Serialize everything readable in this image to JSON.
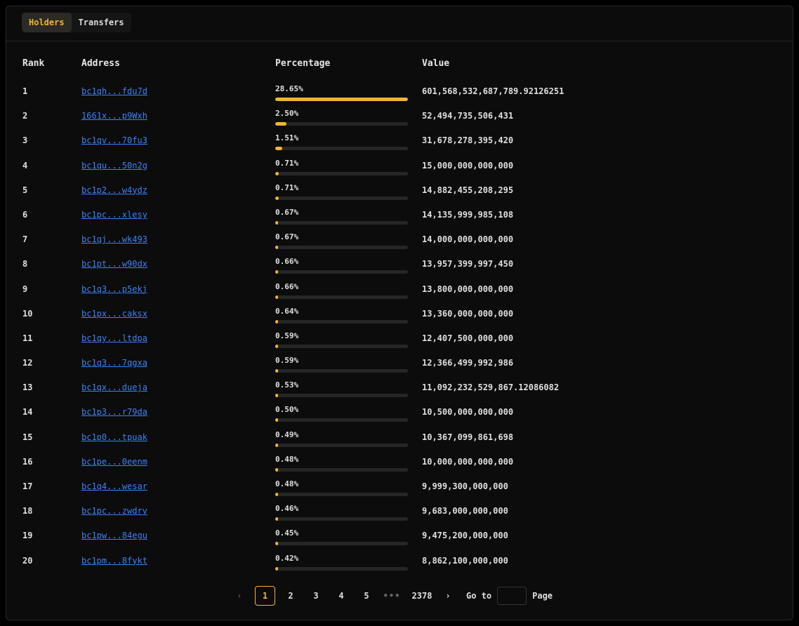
{
  "tabs": [
    {
      "label": "Holders",
      "active": true
    },
    {
      "label": "Transfers",
      "active": false
    }
  ],
  "table": {
    "headers": {
      "rank": "Rank",
      "address": "Address",
      "percentage": "Percentage",
      "value": "Value"
    },
    "rows": [
      {
        "rank": "1",
        "address": "bc1qh...fdu7d",
        "percentage": "28.65%",
        "fraction": 1.0,
        "value": "601,568,532,687,789.92126251"
      },
      {
        "rank": "2",
        "address": "1661x...p9Wxh",
        "percentage": "2.50%",
        "fraction": 0.087,
        "value": "52,494,735,506,431"
      },
      {
        "rank": "3",
        "address": "bc1qv...70fu3",
        "percentage": "1.51%",
        "fraction": 0.053,
        "value": "31,678,278,395,420"
      },
      {
        "rank": "4",
        "address": "bc1qu...50n2g",
        "percentage": "0.71%",
        "fraction": 0.025,
        "value": "15,000,000,000,000"
      },
      {
        "rank": "5",
        "address": "bc1p2...w4ydz",
        "percentage": "0.71%",
        "fraction": 0.025,
        "value": "14,882,455,208,295"
      },
      {
        "rank": "6",
        "address": "bc1pc...xlesy",
        "percentage": "0.67%",
        "fraction": 0.023,
        "value": "14,135,999,985,108"
      },
      {
        "rank": "7",
        "address": "bc1qj...wk493",
        "percentage": "0.67%",
        "fraction": 0.023,
        "value": "14,000,000,000,000"
      },
      {
        "rank": "8",
        "address": "bc1pt...w90dx",
        "percentage": "0.66%",
        "fraction": 0.023,
        "value": "13,957,399,997,450"
      },
      {
        "rank": "9",
        "address": "bc1q3...p5ekj",
        "percentage": "0.66%",
        "fraction": 0.023,
        "value": "13,800,000,000,000"
      },
      {
        "rank": "10",
        "address": "bc1px...caksx",
        "percentage": "0.64%",
        "fraction": 0.022,
        "value": "13,360,000,000,000"
      },
      {
        "rank": "11",
        "address": "bc1qy...ltdpa",
        "percentage": "0.59%",
        "fraction": 0.021,
        "value": "12,407,500,000,000"
      },
      {
        "rank": "12",
        "address": "bc1q3...7qgxa",
        "percentage": "0.59%",
        "fraction": 0.021,
        "value": "12,366,499,992,986"
      },
      {
        "rank": "13",
        "address": "bc1qx...dueja",
        "percentage": "0.53%",
        "fraction": 0.018,
        "value": "11,092,232,529,867.12086082"
      },
      {
        "rank": "14",
        "address": "bc1p3...r79da",
        "percentage": "0.50%",
        "fraction": 0.017,
        "value": "10,500,000,000,000"
      },
      {
        "rank": "15",
        "address": "bc1p0...tpuak",
        "percentage": "0.49%",
        "fraction": 0.017,
        "value": "10,367,099,861,698"
      },
      {
        "rank": "16",
        "address": "bc1pe...0eenm",
        "percentage": "0.48%",
        "fraction": 0.017,
        "value": "10,000,000,000,000"
      },
      {
        "rank": "17",
        "address": "bc1q4...wesar",
        "percentage": "0.48%",
        "fraction": 0.017,
        "value": "9,999,300,000,000"
      },
      {
        "rank": "18",
        "address": "bc1pc...zwdrv",
        "percentage": "0.46%",
        "fraction": 0.016,
        "value": "9,683,000,000,000"
      },
      {
        "rank": "19",
        "address": "bc1pw...84egu",
        "percentage": "0.45%",
        "fraction": 0.016,
        "value": "9,475,200,000,000"
      },
      {
        "rank": "20",
        "address": "bc1pm...8fykt",
        "percentage": "0.42%",
        "fraction": 0.015,
        "value": "8,862,100,000,000"
      }
    ]
  },
  "pagination": {
    "prev_icon": "chevron-left-icon",
    "next_icon": "chevron-right-icon",
    "prev_glyph": "‹",
    "next_glyph": "›",
    "pages": [
      "1",
      "2",
      "3",
      "4",
      "5"
    ],
    "current": "1",
    "ellipsis": "•••",
    "last": "2378",
    "goto_label": "Go to",
    "goto_value": "",
    "page_label": "Page"
  },
  "colors": {
    "accent": "#f3b534",
    "link": "#3b82f6",
    "background": "#0c0c0c"
  }
}
